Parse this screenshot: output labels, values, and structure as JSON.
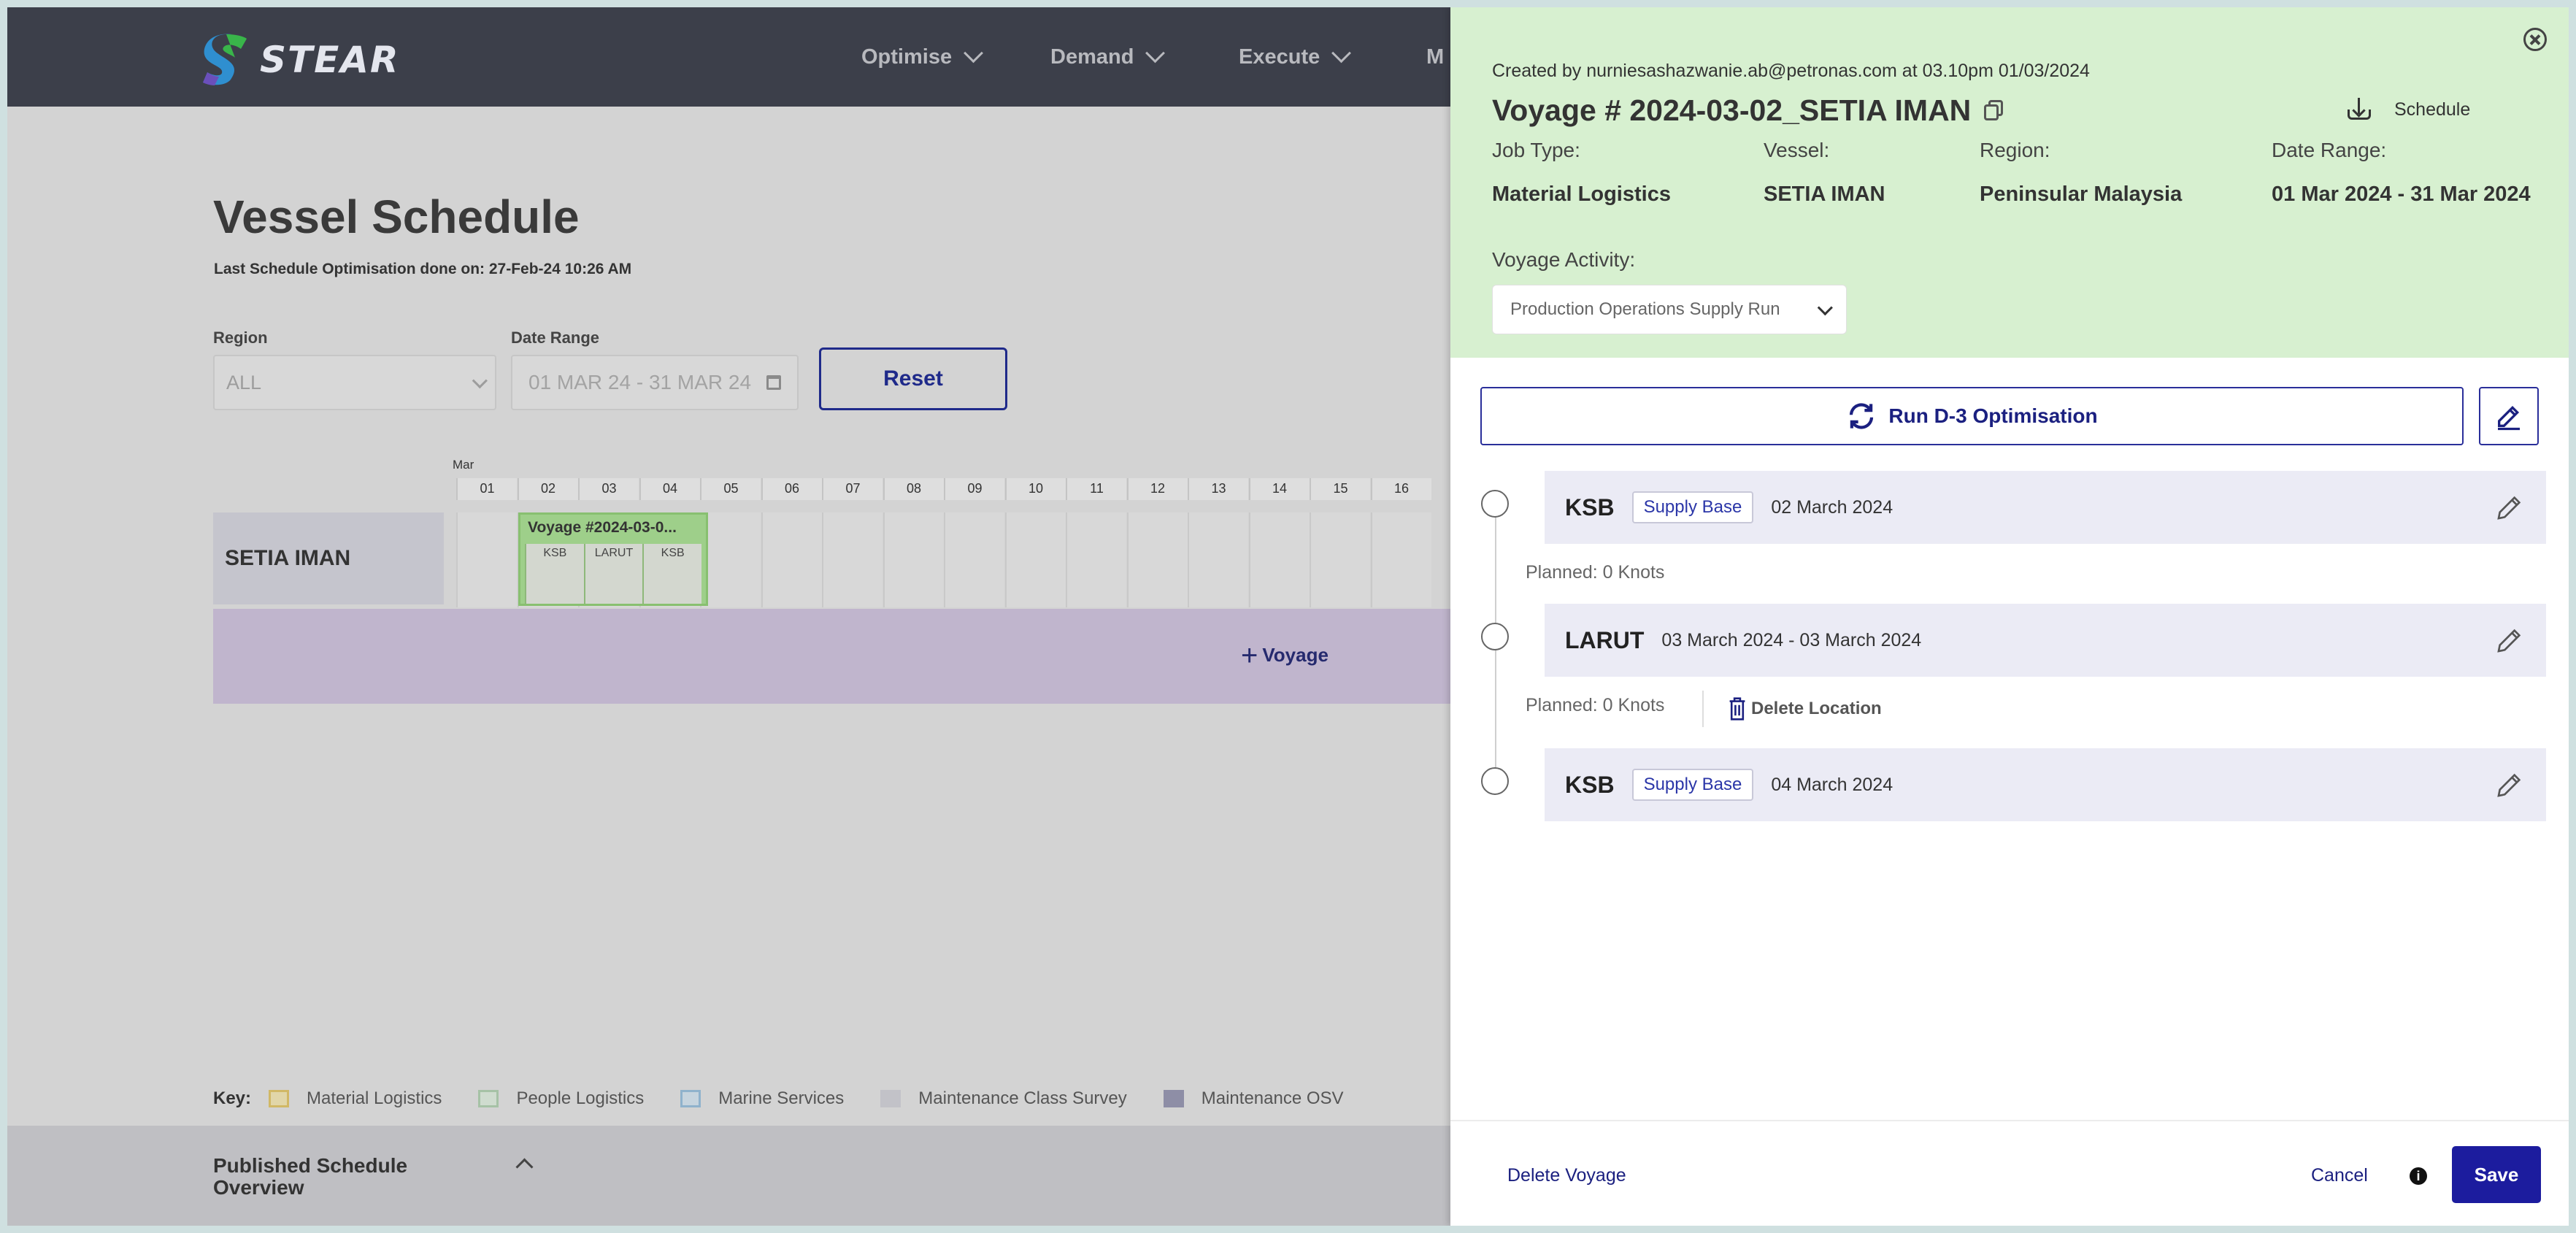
{
  "app": {
    "brand": "STEAR",
    "nav": [
      "Optimise",
      "Demand",
      "Execute",
      "M"
    ]
  },
  "page": {
    "title": "Vessel Schedule",
    "subtitle": "Last Schedule Optimisation done on: 27-Feb-24 10:26 AM"
  },
  "filters": {
    "region_label": "Region",
    "region_value": "ALL",
    "date_label": "Date Range",
    "date_value": "01 MAR 24 - 31 MAR 24",
    "reset_label": "Reset"
  },
  "timeline": {
    "month": "Mar",
    "days": [
      "01",
      "02",
      "03",
      "04",
      "05",
      "06",
      "07",
      "08",
      "09",
      "10",
      "11",
      "12",
      "13",
      "14",
      "15",
      "16"
    ],
    "vessel": "SETIA IMAN",
    "voyage_label": "Voyage #2024-03-0...",
    "voyage_locations": [
      "KSB",
      "LARUT",
      "KSB"
    ],
    "add_voyage": "Voyage"
  },
  "key": {
    "title": "Key:",
    "items": [
      {
        "label": "Material Logistics",
        "color": "#d9c89a"
      },
      {
        "label": "People Logistics",
        "color": "#b8cfb8"
      },
      {
        "label": "Marine Services",
        "color": "#a9c4d6"
      },
      {
        "label": "Maintenance Class Survey",
        "color": "#c2c2c8"
      },
      {
        "label": "Maintenance OSV",
        "color": "#8e8ea6"
      }
    ]
  },
  "published": {
    "title_line1": "Published Schedule",
    "title_line2": "Overview"
  },
  "panel": {
    "created": "Created by nurniesashazwanie.ab@petronas.com at 03.10pm 01/03/2024",
    "title": "Voyage # 2024-03-02_SETIA IMAN",
    "schedule_label": "Schedule",
    "meta": [
      {
        "label": "Job Type:",
        "value": "Material Logistics"
      },
      {
        "label": "Vessel:",
        "value": "SETIA IMAN"
      },
      {
        "label": "Region:",
        "value": "Peninsular Malaysia"
      },
      {
        "label": "Date Range:",
        "value": "01 Mar 2024 - 31 Mar 2024"
      }
    ],
    "activity_label": "Voyage Activity:",
    "activity_value": "Production Operations Supply Run",
    "run_label": "Run D-3 Optimisation",
    "stops": [
      {
        "name": "KSB",
        "tag": "Supply Base",
        "date": "02 March 2024",
        "planned": "Planned: 0 Knots"
      },
      {
        "name": "LARUT",
        "tag": "",
        "date": "03 March 2024 - 03 March 2024",
        "planned": "Planned: 0 Knots"
      },
      {
        "name": "KSB",
        "tag": "Supply Base",
        "date": "04 March 2024"
      }
    ],
    "delete_location": "Delete Location",
    "delete_voyage": "Delete Voyage",
    "cancel": "Cancel",
    "save": "Save",
    "info": "i"
  }
}
